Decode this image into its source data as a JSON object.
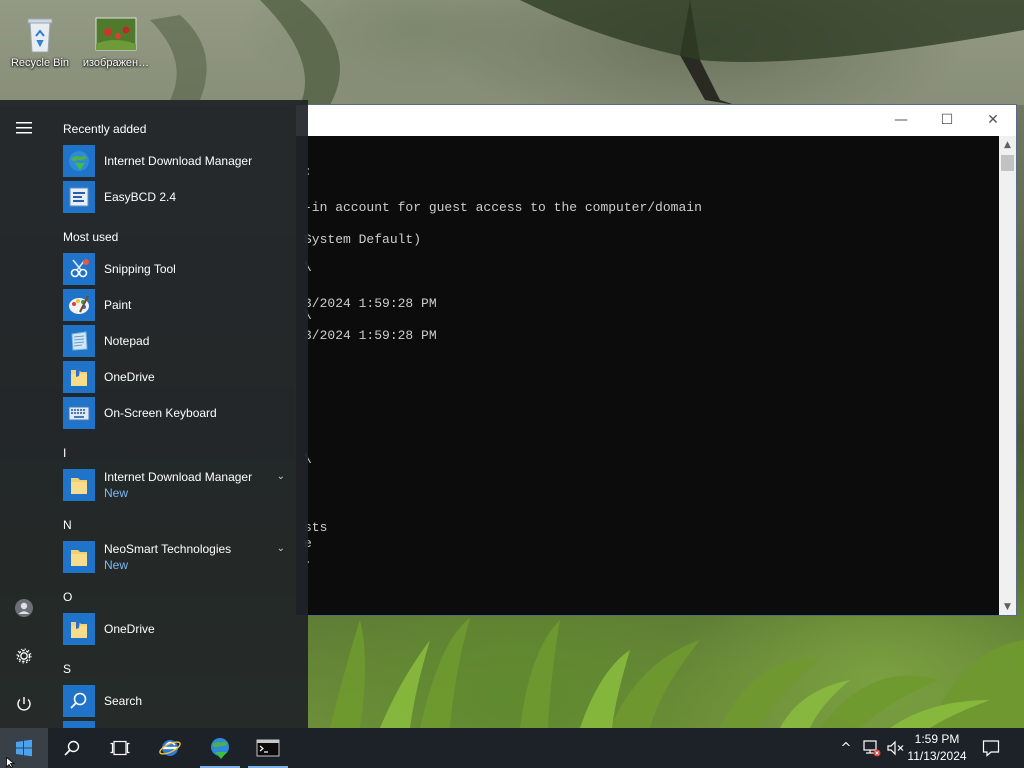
{
  "desktop": {
    "icons": [
      {
        "label": "Recycle Bin",
        "icon": "recycle-bin-icon"
      },
      {
        "label": "изображен…",
        "icon": "image-file-icon"
      }
    ]
  },
  "window": {
    "controls": {
      "minimize": "—",
      "maximize": "☐",
      "close": "✕"
    },
    "console_lines": [
      {
        "text": ":"
      },
      {
        "text": "-in account for guest access to the computer/domain"
      },
      {
        "text": "System Default)"
      },
      {
        "text": "\\"
      },
      {
        "text": "3/2024 1:59:28 PM"
      },
      {
        "text": "\\"
      },
      {
        "text": "3/2024 1:59:28 PM"
      },
      {
        "text": "\\"
      },
      {
        "text": "sts"
      },
      {
        "text": "e"
      },
      {
        "text": "."
      }
    ]
  },
  "start_menu": {
    "menu_icon": "hamburger-menu-icon",
    "recently_added_title": "Recently added",
    "recently_added": [
      {
        "name": "Internet Download Manager",
        "icon": "idm-globe-icon"
      },
      {
        "name": "EasyBCD 2.4",
        "icon": "easybcd-icon"
      }
    ],
    "most_used_title": "Most used",
    "most_used": [
      {
        "name": "Snipping Tool",
        "icon": "snipping-tool-icon"
      },
      {
        "name": "Paint",
        "icon": "paint-palette-icon"
      },
      {
        "name": "Notepad",
        "icon": "notepad-icon"
      },
      {
        "name": "OneDrive",
        "icon": "onedrive-folder-icon"
      },
      {
        "name": "On-Screen Keyboard",
        "icon": "keyboard-icon"
      }
    ],
    "groups": [
      {
        "letter": "I",
        "items": [
          {
            "name": "Internet Download Manager",
            "sub": "New",
            "icon": "folder-icon",
            "expand": "⌄"
          }
        ]
      },
      {
        "letter": "N",
        "items": [
          {
            "name": "NeoSmart Technologies",
            "sub": "New",
            "icon": "folder-icon",
            "expand": "⌄"
          }
        ]
      },
      {
        "letter": "O",
        "items": [
          {
            "name": "OneDrive",
            "icon": "onedrive-folder-icon"
          }
        ]
      },
      {
        "letter": "S",
        "items": [
          {
            "name": "Search",
            "icon": "search-icon"
          }
        ]
      }
    ],
    "rail": {
      "user": "user-icon",
      "settings": "gear-icon",
      "power": "power-icon"
    }
  },
  "taskbar": {
    "buttons": [
      "windows-start-icon",
      "search-icon",
      "task-view-icon",
      "internet-explorer-icon",
      "idm-globe-icon",
      "command-prompt-icon"
    ],
    "tray": {
      "chevron": "^",
      "network": "network-disconnected-icon",
      "volume": "volume-muted-icon",
      "notification": "action-center-icon"
    },
    "clock": {
      "time": "1:59 PM",
      "date": "11/13/2024"
    }
  },
  "colors": {
    "accent": "#1f74c9",
    "start_bg": "#202428",
    "taskbar_bg": "#1c2228",
    "new_label": "#7cb8f2"
  }
}
